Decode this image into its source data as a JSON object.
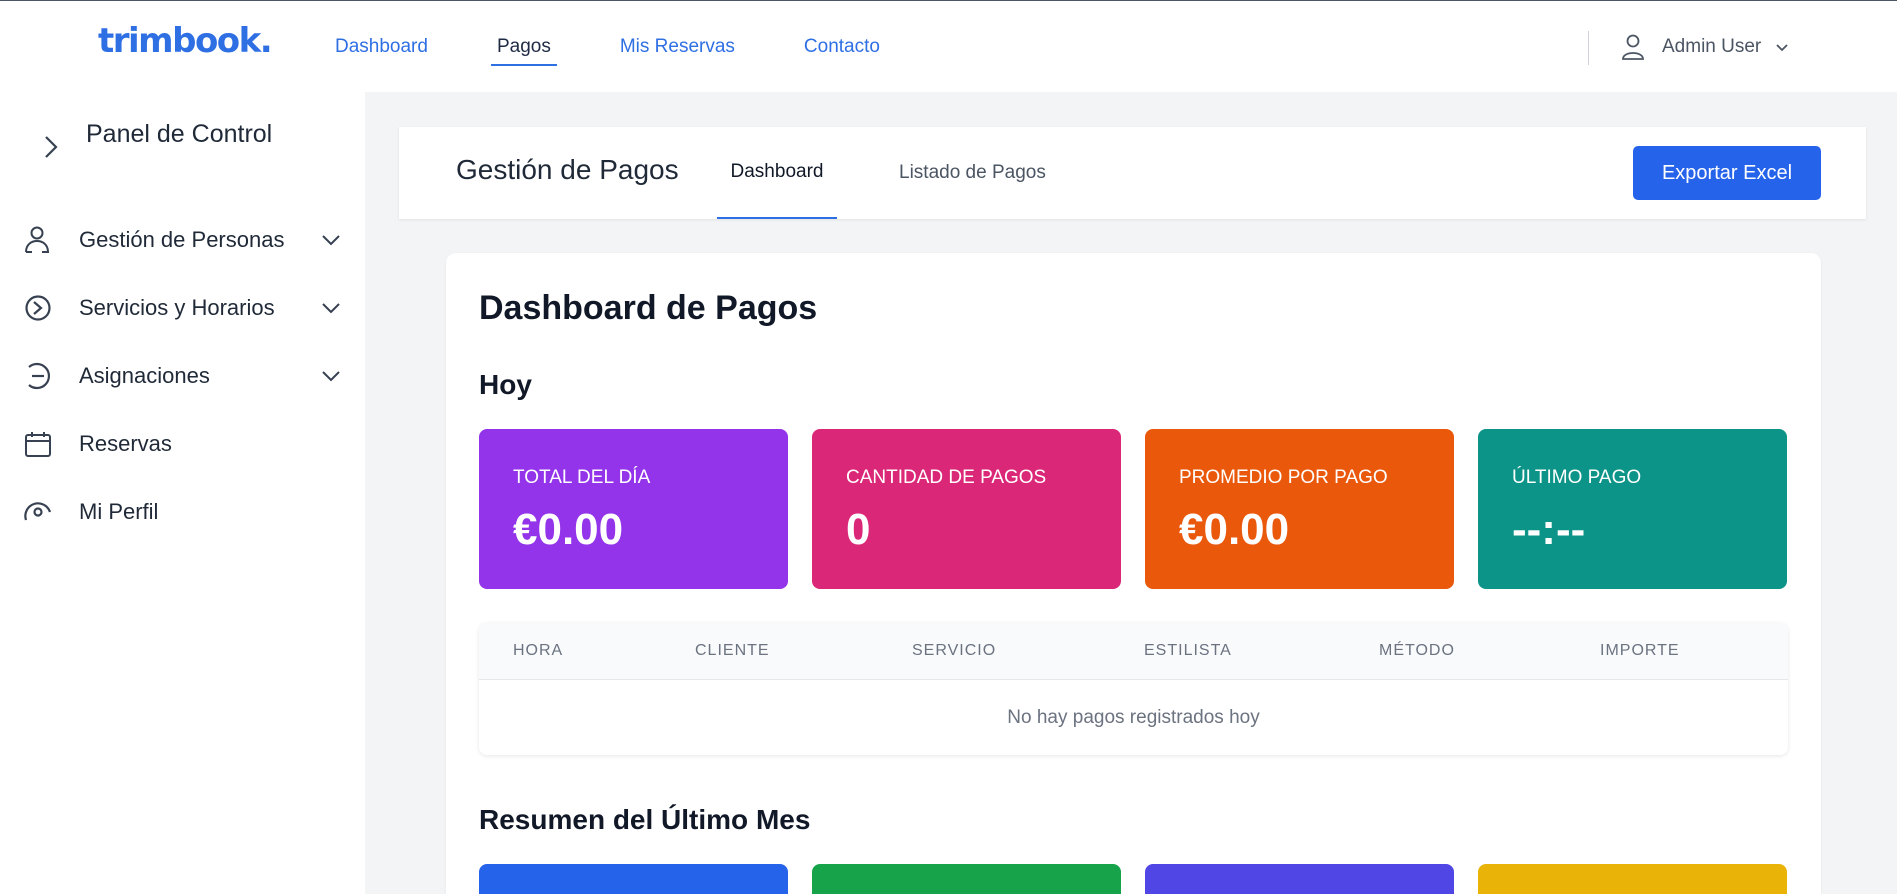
{
  "brand": {
    "logo": "trimbook."
  },
  "nav": {
    "items": [
      {
        "label": "Dashboard",
        "active": false
      },
      {
        "label": "Pagos",
        "active": true
      },
      {
        "label": "Mis Reservas",
        "active": false
      },
      {
        "label": "Contacto",
        "active": false
      }
    ]
  },
  "user": {
    "name": "Admin User",
    "icon": "user-icon"
  },
  "sidebar": {
    "title": "Panel de Control",
    "items": [
      {
        "label": "Gestión de Personas",
        "icon": "people-icon",
        "expandable": true
      },
      {
        "label": "Servicios y Horarios",
        "icon": "services-icon",
        "expandable": true
      },
      {
        "label": "Asignaciones",
        "icon": "assign-icon",
        "expandable": true
      },
      {
        "label": "Reservas",
        "icon": "calendar-icon",
        "expandable": false
      },
      {
        "label": "Mi Perfil",
        "icon": "profile-icon",
        "expandable": false
      }
    ]
  },
  "header": {
    "title": "Gestión de Pagos",
    "tabs": [
      {
        "label": "Dashboard",
        "active": true
      },
      {
        "label": "Listado de Pagos",
        "active": false
      }
    ],
    "export_label": "Exportar Excel"
  },
  "main": {
    "title": "Dashboard de Pagos",
    "today": {
      "title": "Hoy",
      "stats": [
        {
          "label": "TOTAL DEL DÍA",
          "value": "€0.00",
          "color": "#9333ea"
        },
        {
          "label": "CANTIDAD DE PAGOS",
          "value": "0",
          "color": "#db2777"
        },
        {
          "label": "PROMEDIO POR PAGO",
          "value": "€0.00",
          "color": "#ea580c"
        },
        {
          "label": "ÚLTIMO PAGO",
          "value": "--:--",
          "color": "#0d9488"
        }
      ]
    },
    "table": {
      "columns": [
        "HORA",
        "CLIENTE",
        "SERVICIO",
        "ESTILISTA",
        "MÉTODO",
        "IMPORTE"
      ],
      "empty_message": "No hay pagos registrados hoy"
    },
    "month": {
      "title": "Resumen del Último Mes",
      "card_colors": [
        "#2563eb",
        "#16a34a",
        "#4f46e5",
        "#eab308"
      ]
    }
  },
  "colors": {
    "accent": "#2563eb",
    "link": "#2f6fe4"
  }
}
